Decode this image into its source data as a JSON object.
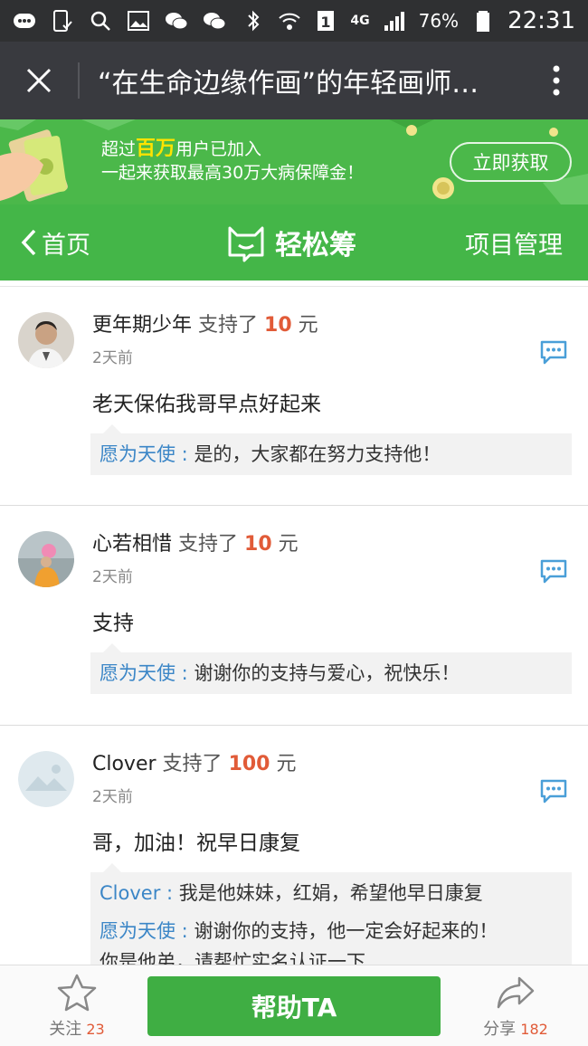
{
  "status_bar": {
    "network": "4G",
    "battery": "76%",
    "time": "22:31"
  },
  "webview": {
    "title": "“在生命边缘作画”的年轻画师…"
  },
  "banner": {
    "line1_pre": "超过",
    "line1_highlight": "百万",
    "line1_post": "用户已加入",
    "line2": "一起来获取最高30万大病保障金！",
    "cta": "立即获取"
  },
  "nav": {
    "back": "首页",
    "logo_text": "轻松筹",
    "manage": "项目管理"
  },
  "comments": [
    {
      "name": "更年期少年",
      "verb": "支持了",
      "amount": "10",
      "unit": "元",
      "time": "2天前",
      "message": "老天保佑我哥早点好起来",
      "replies": [
        {
          "name": "愿为天使",
          "sep": " : ",
          "text": "是的，大家都在努力支持他！"
        }
      ]
    },
    {
      "name": "心若相惜",
      "verb": "支持了",
      "amount": "10",
      "unit": "元",
      "time": "2天前",
      "message": "支持",
      "replies": [
        {
          "name": "愿为天使",
          "sep": " : ",
          "text": "谢谢你的支持与爱心，祝快乐！"
        }
      ]
    },
    {
      "name": "Clover",
      "verb": "支持了",
      "amount": "100",
      "unit": "元",
      "time": "2天前",
      "message": "哥，加油！祝早日康复",
      "replies": [
        {
          "name": "Clover",
          "sep": " : ",
          "text": "我是他妹妹，红娟，希望他早日康复"
        },
        {
          "name": "愿为天使",
          "sep": " : ",
          "text": "谢谢你的支持，他一定会好起来的！"
        },
        {
          "name": "",
          "sep": "",
          "text": "你是他弟，请帮忙实名认证一下"
        }
      ]
    }
  ],
  "bottom": {
    "follow_label": "关注",
    "follow_count": "23",
    "help": "帮助TA",
    "share_label": "分享",
    "share_count": "182"
  },
  "colors": {
    "brand_green": "#44b648",
    "amount_red": "#e15b38",
    "reply_blue": "#3b86c7",
    "highlight_yellow": "#ffe300"
  }
}
